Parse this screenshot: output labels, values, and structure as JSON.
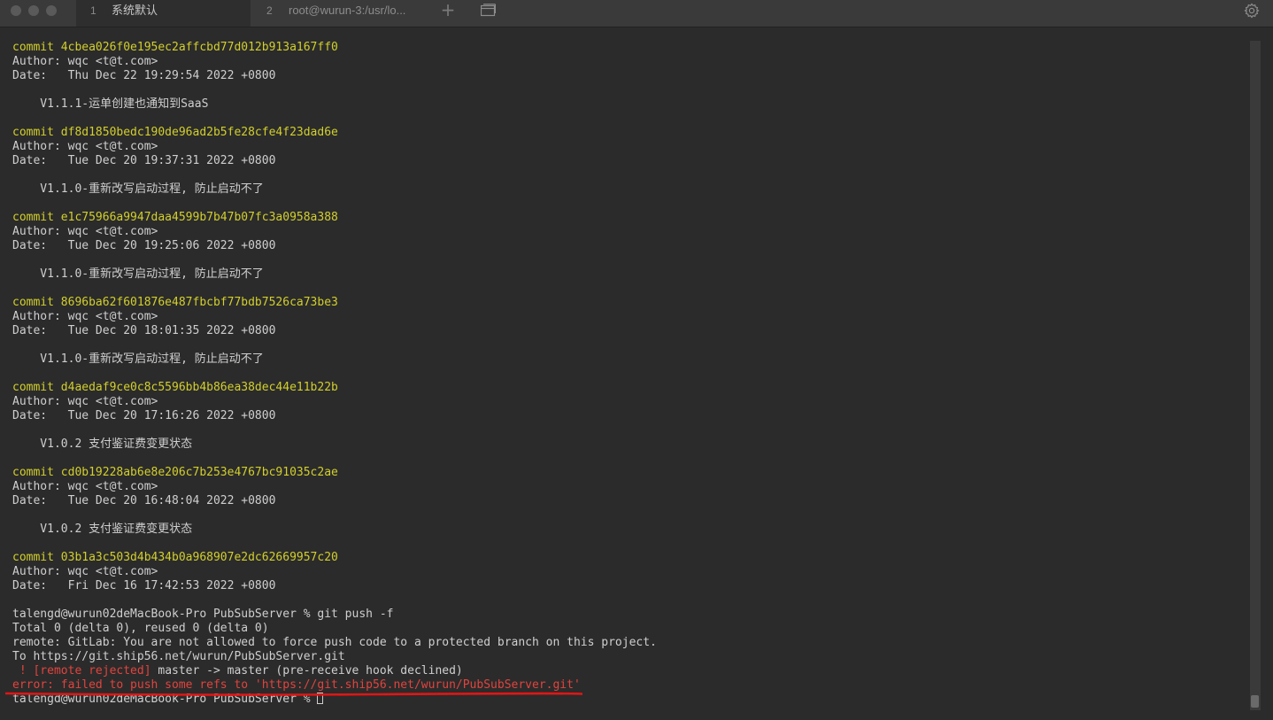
{
  "tabs": [
    {
      "number": "1",
      "label": "系统默认"
    },
    {
      "number": "2",
      "label": "root@wurun-3:/usr/lo..."
    }
  ],
  "icons": {
    "add_tab": "+",
    "new_window": "tabs-icon",
    "settings": "gear-icon"
  },
  "colors": {
    "background": "#2b2b2b",
    "commit_yellow": "#d2cf2c",
    "error_red": "#e0443e",
    "text": "#cfcfcf",
    "annotation_red": "#e01616"
  },
  "log": [
    {
      "commit": "commit 4cbea026f0e195ec2affcbd77d012b913a167ff0",
      "author": "Author: wqc <t@t.com>",
      "date": "Date:   Thu Dec 22 19:29:54 2022 +0800",
      "message": "    V1.1.1-运单创建也通知到SaaS"
    },
    {
      "commit": "commit df8d1850bedc190de96ad2b5fe28cfe4f23dad6e",
      "author": "Author: wqc <t@t.com>",
      "date": "Date:   Tue Dec 20 19:37:31 2022 +0800",
      "message": "    V1.1.0-重新改写启动过程, 防止启动不了"
    },
    {
      "commit": "commit e1c75966a9947daa4599b7b47b07fc3a0958a388",
      "author": "Author: wqc <t@t.com>",
      "date": "Date:   Tue Dec 20 19:25:06 2022 +0800",
      "message": "    V1.1.0-重新改写启动过程, 防止启动不了"
    },
    {
      "commit": "commit 8696ba62f601876e487fbcbf77bdb7526ca73be3",
      "author": "Author: wqc <t@t.com>",
      "date": "Date:   Tue Dec 20 18:01:35 2022 +0800",
      "message": "    V1.1.0-重新改写启动过程, 防止启动不了"
    },
    {
      "commit": "commit d4aedaf9ce0c8c5596bb4b86ea38dec44e11b22b",
      "author": "Author: wqc <t@t.com>",
      "date": "Date:   Tue Dec 20 17:16:26 2022 +0800",
      "message": "    V1.0.2 支付鉴证费变更状态"
    },
    {
      "commit": "commit cd0b19228ab6e8e206c7b253e4767bc91035c2ae",
      "author": "Author: wqc <t@t.com>",
      "date": "Date:   Tue Dec 20 16:48:04 2022 +0800",
      "message": "    V1.0.2 支付鉴证费变更状态"
    },
    {
      "commit": "commit 03b1a3c503d4b434b0a968907e2dc62669957c20",
      "author": "Author: wqc <t@t.com>",
      "date": "Date:   Fri Dec 16 17:42:53 2022 +0800",
      "message": ""
    }
  ],
  "push": {
    "command": "talengd@wurun02deMacBook-Pro PubSubServer % git push -f",
    "total": "Total 0 (delta 0), reused 0 (delta 0)",
    "remote": "remote: GitLab: You are not allowed to force push code to a protected branch on this project.",
    "to": "To https://git.ship56.net/wurun/PubSubServer.git",
    "rejected_tag": " ! [remote rejected]",
    "rejected_rest": " master -> master (pre-receive hook declined)",
    "error": "error: failed to push some refs to 'https://git.ship56.net/wurun/PubSubServer.git'",
    "prompt": "talengd@wurun02deMacBook-Pro PubSubServer % "
  }
}
